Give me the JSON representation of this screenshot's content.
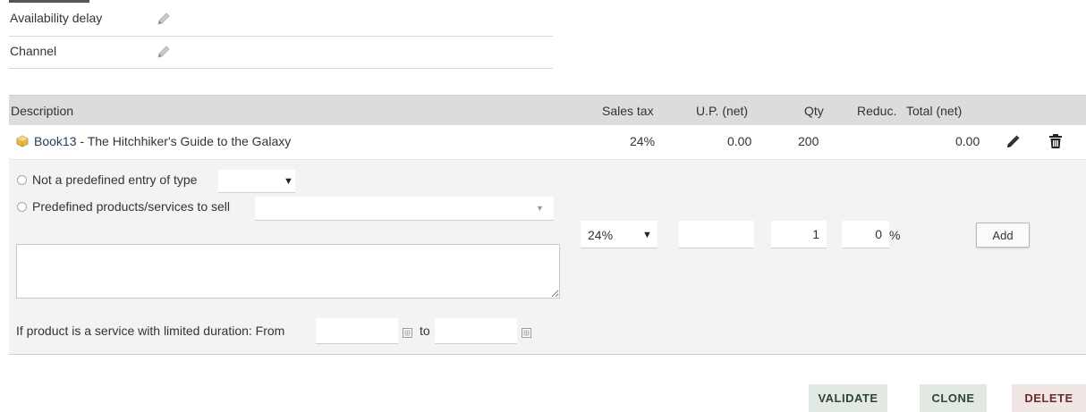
{
  "properties": [
    {
      "label": "Availability delay"
    },
    {
      "label": "Channel"
    }
  ],
  "table": {
    "headers": {
      "description": "Description",
      "sales_tax": "Sales tax",
      "up_net": "U.P. (net)",
      "qty": "Qty",
      "reduc": "Reduc.",
      "total_net": "Total (net)"
    },
    "rows": [
      {
        "product": "Book13",
        "separator": " - ",
        "label": "The Hitchhiker's Guide to the Galaxy",
        "sales_tax": "24%",
        "up_net": "0.00",
        "qty": "200",
        "reduc": "",
        "total_net": "0.00"
      }
    ]
  },
  "add_line": {
    "radio_free_label": "Not a predefined entry of type",
    "radio_predefined_label": "Predefined products/services to sell",
    "tax_select_value": "24%",
    "up_value": "",
    "qty_value": "1",
    "reduc_value": "0",
    "reduc_unit": "%",
    "add_button": "Add",
    "description_value": "",
    "duration_label": "If product is a service with limited duration: From",
    "duration_to": "to",
    "date_from": "",
    "date_to": ""
  },
  "actions": {
    "validate": "VALIDATE",
    "clone": "CLONE",
    "delete": "DELETE"
  },
  "icons": {
    "edit": "pencil-icon",
    "delete": "trash-icon",
    "product": "product-type-icon",
    "calendar": "calendar-icon",
    "dropdown": "chevron-down-icon"
  },
  "colors": {
    "header_bg": "#dcdcdc",
    "addzone_bg": "#f3f3f3",
    "product_link": "#263c5c",
    "validate_bg": "#e2e9e3",
    "validate_fg": "#2f4536",
    "clone_bg": "#e2e9e3",
    "clone_fg": "#2f4536",
    "delete_bg": "#f0e6e4",
    "delete_fg": "#6a2b2b"
  }
}
